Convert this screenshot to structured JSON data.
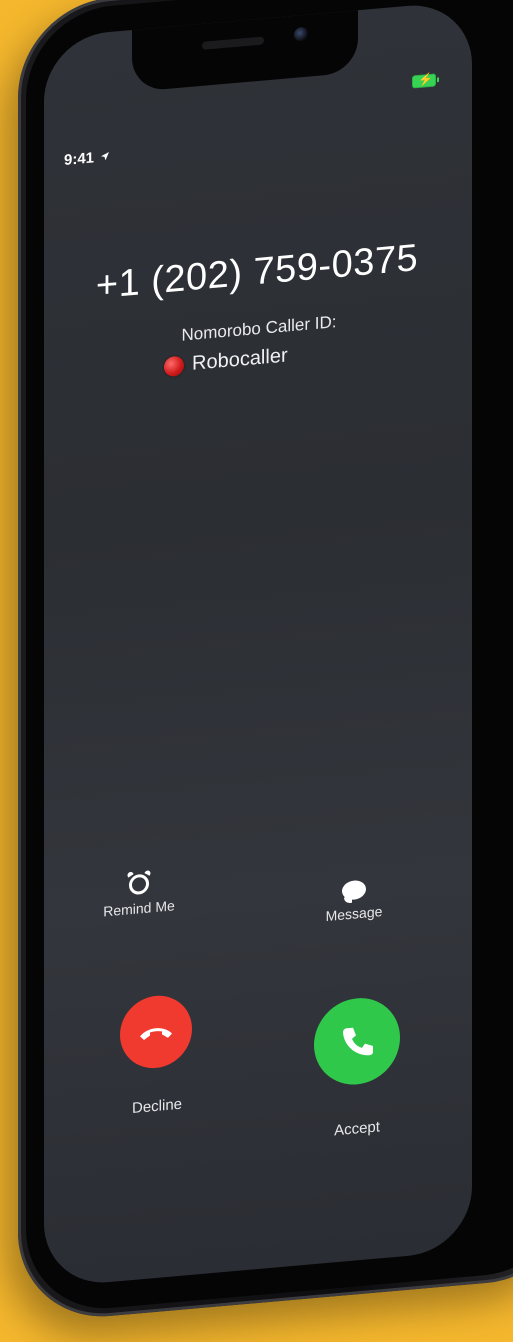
{
  "status": {
    "time": "9:41"
  },
  "call": {
    "number": "+1 (202) 759-0375",
    "caller_id_label": "Nomorobo Caller ID:",
    "caller_id_name": "Robocaller"
  },
  "actions": {
    "remind_label": "Remind Me",
    "message_label": "Message"
  },
  "buttons": {
    "decline_label": "Decline",
    "accept_label": "Accept"
  },
  "colors": {
    "background": "#F5B72D",
    "decline": "#F13A2F",
    "accept": "#30C84A",
    "battery": "#37D354"
  },
  "icons": {
    "status_location": "location-arrow-icon",
    "battery": "battery-charging-icon",
    "remind": "alarm-clock-icon",
    "message": "message-bubble-icon",
    "decline": "phone-hangup-icon",
    "accept": "phone-icon",
    "robocaller_marker": "red-dot-icon"
  }
}
